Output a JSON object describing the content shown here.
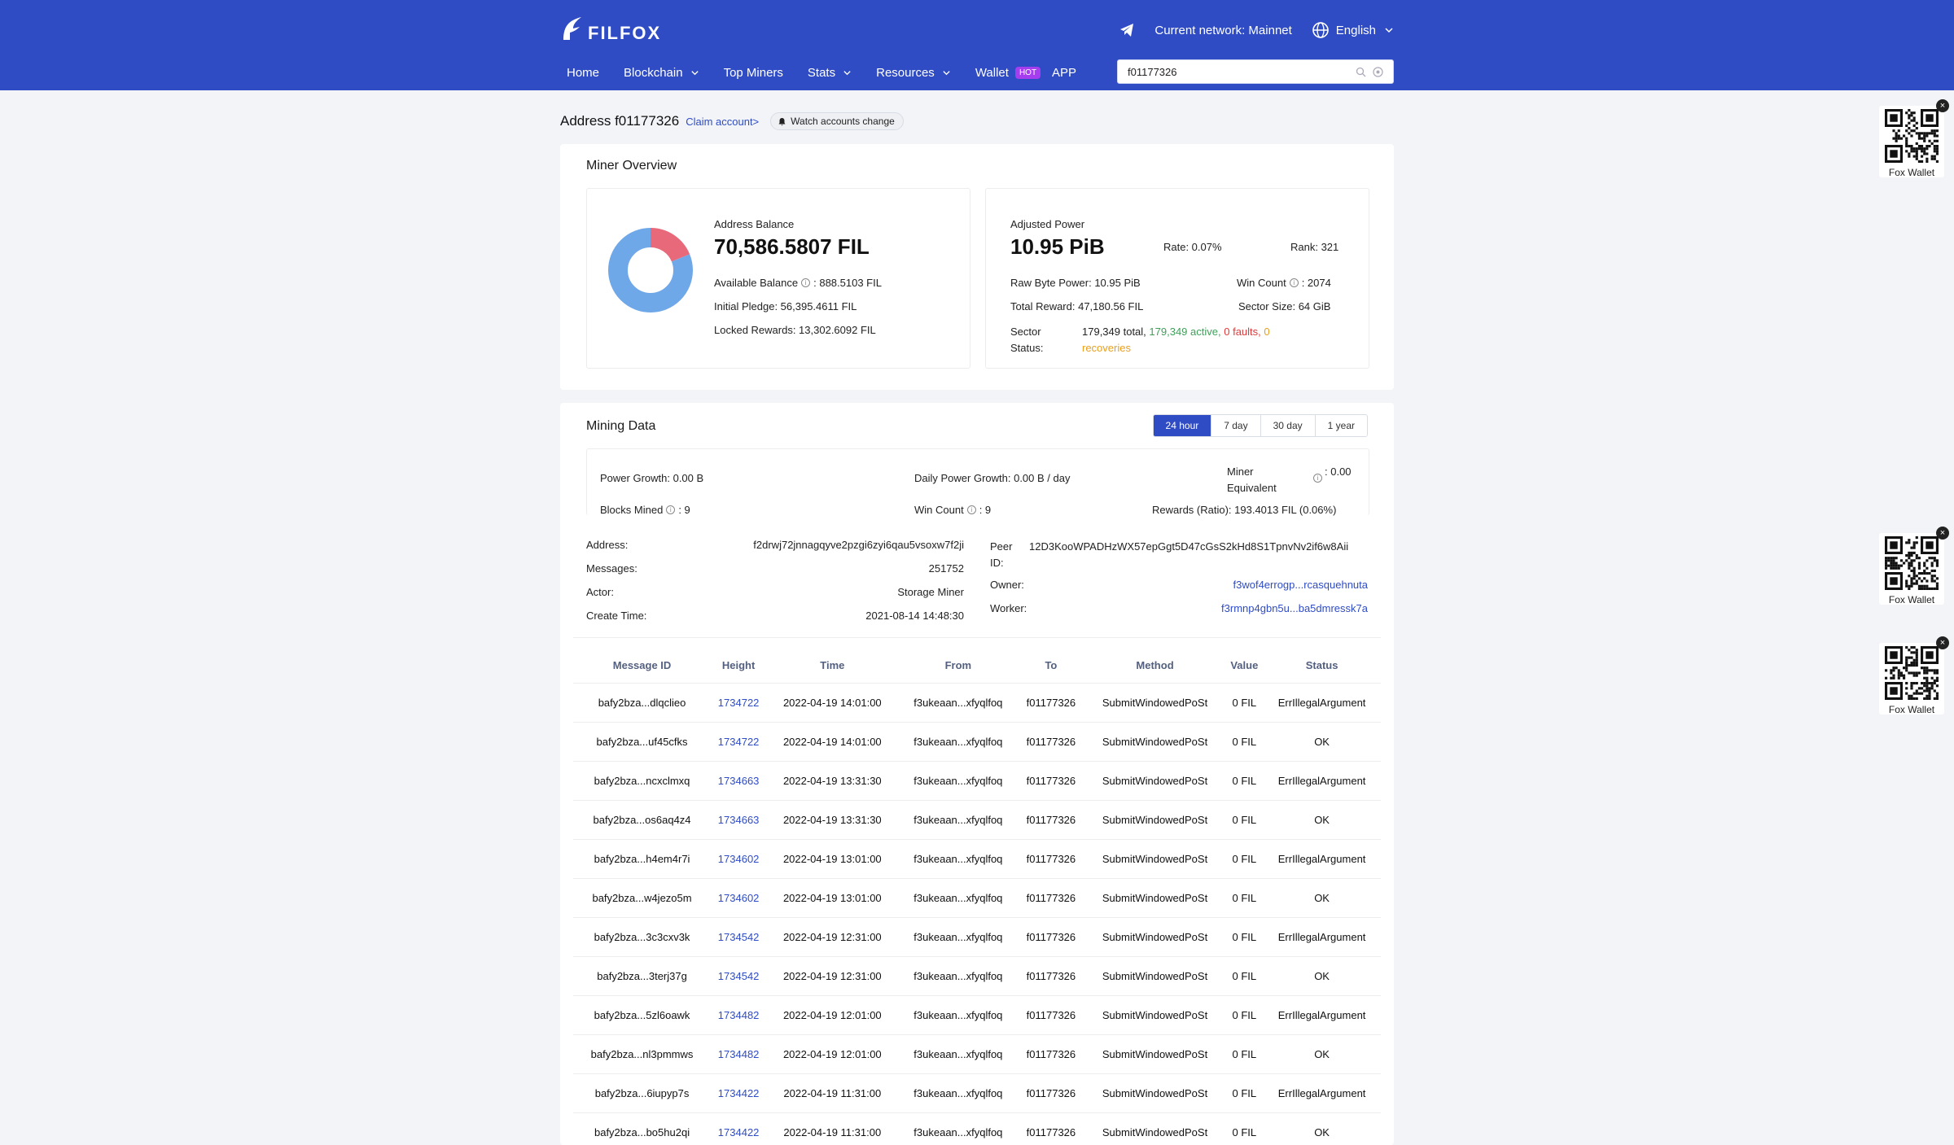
{
  "header": {
    "logo": "FILFOX",
    "network_label": "Current network: Mainnet",
    "language": "English",
    "nav": [
      {
        "label": "Home"
      },
      {
        "label": "Blockchain"
      },
      {
        "label": "Top Miners"
      },
      {
        "label": "Stats"
      },
      {
        "label": "Resources"
      },
      {
        "label": "Wallet"
      },
      {
        "label": "APP"
      }
    ],
    "hot_badge": "HOT",
    "search_value": "f01177326"
  },
  "page": {
    "title": "Address f01177326",
    "claim": "Claim account>",
    "watch": "Watch accounts change"
  },
  "overview": {
    "title": "Miner Overview",
    "balance_label": "Address Balance",
    "balance_value": "70,586.5807 FIL",
    "available_label": "Available Balance",
    "available_value": ": 888.5103 FIL",
    "initial_pledge": "Initial Pledge: 56,395.4611 FIL",
    "locked_rewards": "Locked Rewards: 13,302.6092 FIL",
    "donut": {
      "pledge_fraction": 0.799,
      "locked_fraction": 0.188,
      "available_fraction": 0.013,
      "pledge_color": "#6fa8e8",
      "locked_color": "#e86a7a"
    },
    "power_label": "Adjusted Power",
    "power_value": "10.95 PiB",
    "rate": "Rate: 0.07%",
    "rank": "Rank: 321",
    "raw_power": "Raw Byte Power: 10.95 PiB",
    "win_count_label": "Win Count",
    "win_count_value": ": 2074",
    "total_reward": "Total Reward: 47,180.56 FIL",
    "sector_size": "Sector Size: 64 GiB",
    "sector_status_label": "Sector Status:",
    "sector_total": "179,349 total,",
    "sector_active": "179,349 active,",
    "sector_faults": "0 faults,",
    "sector_recoveries": "0 recoveries"
  },
  "mining": {
    "title": "Mining Data",
    "periods": [
      "24 hour",
      "7 day",
      "30 day",
      "1 year"
    ],
    "power_growth": "Power Growth: 0.00 B",
    "daily_power_growth": "Daily Power Growth: 0.00 B / day",
    "miner_equivalent_label": "Miner Equivalent",
    "miner_equivalent_value": ": 0.00",
    "blocks_mined_label": "Blocks Mined",
    "blocks_mined_value": ": 9",
    "win_count_label": "Win Count",
    "win_count_value": ": 9",
    "rewards_ratio": "Rewards (Ratio): 193.4013 FIL (0.06%)"
  },
  "info": {
    "address_label": "Address:",
    "address_value": "f2drwj72jnnagqyve2pzgi6zyi6qau5vsoxw7f2ji",
    "messages_label": "Messages:",
    "messages_value": "251752",
    "actor_label": "Actor:",
    "actor_value": "Storage Miner",
    "create_label": "Create Time:",
    "create_value": "2021-08-14 14:48:30",
    "peer_label": "Peer ID:",
    "peer_value": "12D3KooWPADHzWX57epGgt5D47cGsS2kHd8S1TpnvNv2if6w8Aii",
    "owner_label": "Owner:",
    "owner_value": "f3wof4errogp...rcasquehnuta",
    "worker_label": "Worker:",
    "worker_value": "f3rmnp4gbn5u...ba5dmressk7a"
  },
  "table": {
    "headers": [
      "Message ID",
      "Height",
      "Time",
      "From",
      "To",
      "Method",
      "Value",
      "Status"
    ],
    "rows": [
      [
        "bafy2bza...dlqclieo",
        "1734722",
        "2022-04-19 14:01:00",
        "f3ukeaan...xfyqlfoq",
        "f01177326",
        "SubmitWindowedPoSt",
        "0 FIL",
        "ErrIllegalArgument"
      ],
      [
        "bafy2bza...uf45cfks",
        "1734722",
        "2022-04-19 14:01:00",
        "f3ukeaan...xfyqlfoq",
        "f01177326",
        "SubmitWindowedPoSt",
        "0 FIL",
        "OK"
      ],
      [
        "bafy2bza...ncxclmxq",
        "1734663",
        "2022-04-19 13:31:30",
        "f3ukeaan...xfyqlfoq",
        "f01177326",
        "SubmitWindowedPoSt",
        "0 FIL",
        "ErrIllegalArgument"
      ],
      [
        "bafy2bza...os6aq4z4",
        "1734663",
        "2022-04-19 13:31:30",
        "f3ukeaan...xfyqlfoq",
        "f01177326",
        "SubmitWindowedPoSt",
        "0 FIL",
        "OK"
      ],
      [
        "bafy2bza...h4em4r7i",
        "1734602",
        "2022-04-19 13:01:00",
        "f3ukeaan...xfyqlfoq",
        "f01177326",
        "SubmitWindowedPoSt",
        "0 FIL",
        "ErrIllegalArgument"
      ],
      [
        "bafy2bza...w4jezo5m",
        "1734602",
        "2022-04-19 13:01:00",
        "f3ukeaan...xfyqlfoq",
        "f01177326",
        "SubmitWindowedPoSt",
        "0 FIL",
        "OK"
      ],
      [
        "bafy2bza...3c3cxv3k",
        "1734542",
        "2022-04-19 12:31:00",
        "f3ukeaan...xfyqlfoq",
        "f01177326",
        "SubmitWindowedPoSt",
        "0 FIL",
        "ErrIllegalArgument"
      ],
      [
        "bafy2bza...3terj37g",
        "1734542",
        "2022-04-19 12:31:00",
        "f3ukeaan...xfyqlfoq",
        "f01177326",
        "SubmitWindowedPoSt",
        "0 FIL",
        "OK"
      ],
      [
        "bafy2bza...5zl6oawk",
        "1734482",
        "2022-04-19 12:01:00",
        "f3ukeaan...xfyqlfoq",
        "f01177326",
        "SubmitWindowedPoSt",
        "0 FIL",
        "ErrIllegalArgument"
      ],
      [
        "bafy2bza...nl3pmmws",
        "1734482",
        "2022-04-19 12:01:00",
        "f3ukeaan...xfyqlfoq",
        "f01177326",
        "SubmitWindowedPoSt",
        "0 FIL",
        "OK"
      ],
      [
        "bafy2bza...6iupyp7s",
        "1734422",
        "2022-04-19 11:31:00",
        "f3ukeaan...xfyqlfoq",
        "f01177326",
        "SubmitWindowedPoSt",
        "0 FIL",
        "ErrIllegalArgument"
      ],
      [
        "bafy2bza...bo5hu2qi",
        "1734422",
        "2022-04-19 11:31:00",
        "f3ukeaan...xfyqlfoq",
        "f01177326",
        "SubmitWindowedPoSt",
        "0 FIL",
        "OK"
      ]
    ]
  },
  "qr_widgets": [
    {
      "caption": "Fox Wallet"
    },
    {
      "caption": "Fox Wallet"
    },
    {
      "caption": "Fox Wallet"
    }
  ],
  "colors": {
    "brand": "#2f4cc4",
    "active_sectors": "#3fa05a",
    "faults": "#e03a3a",
    "recoveries": "#e8a020"
  }
}
